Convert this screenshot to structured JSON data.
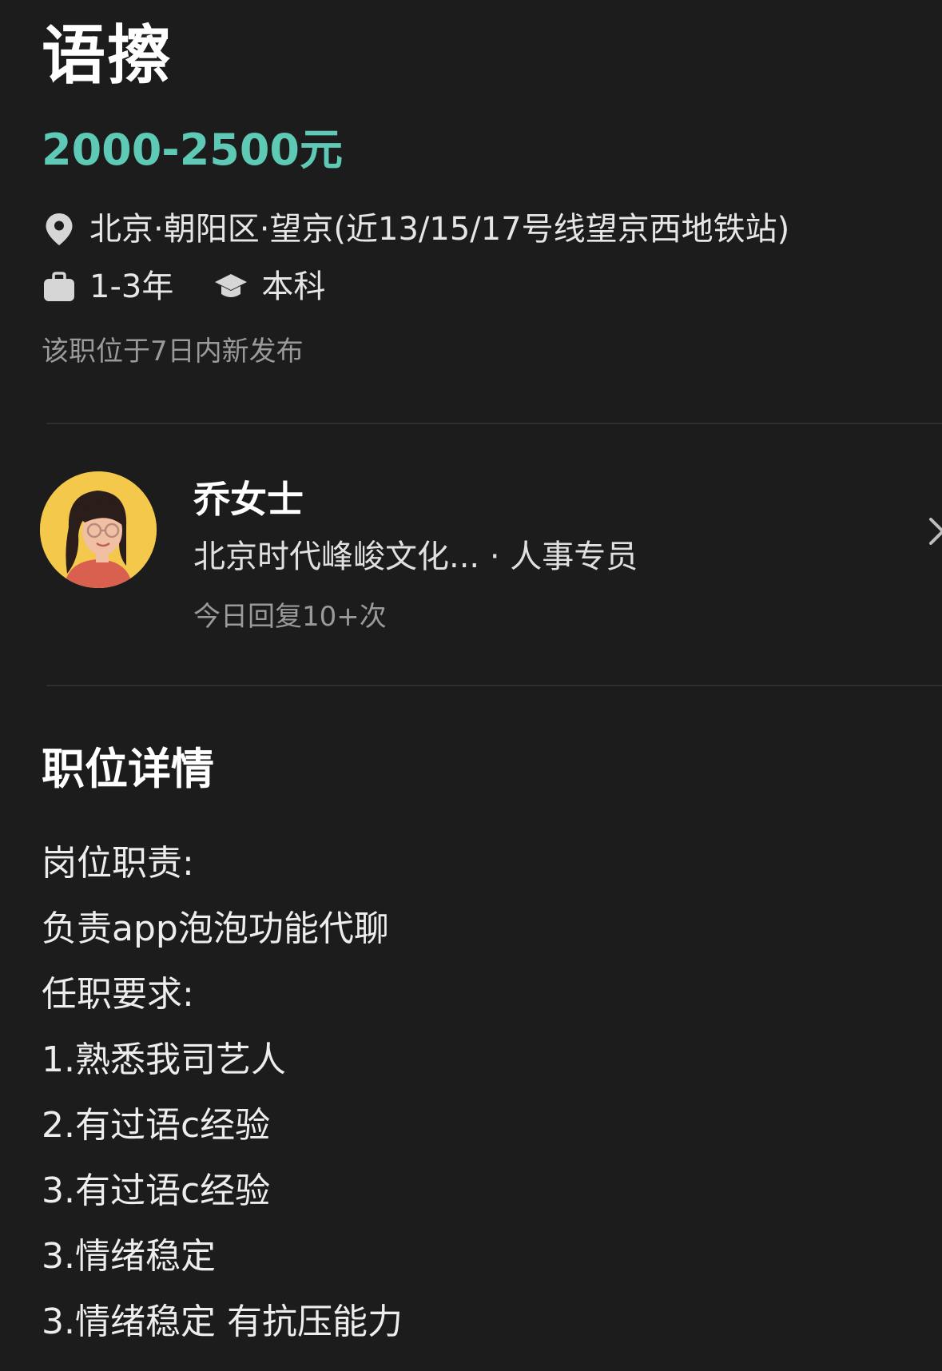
{
  "job": {
    "title": "语擦",
    "salary": "2000-2500元",
    "location": "北京·朝阳区·望京(近13/15/17号线望京西地铁站)",
    "experience": "1-3年",
    "education": "本科",
    "posted_note": "该职位于7日内新发布"
  },
  "icons": {
    "location": "location-pin-icon",
    "experience": "briefcase-icon",
    "education": "graduation-cap-icon",
    "recruiter_link": "chevron-right-icon"
  },
  "recruiter": {
    "name": "乔女士",
    "company_role": "北京时代峰峻文化... · 人事专员",
    "activity": "今日回复10+次"
  },
  "details": {
    "section_title": "职位详情",
    "lines": [
      "岗位职责:",
      "负责app泡泡功能代聊",
      "任职要求:",
      "1.熟悉我司艺人",
      "2.有过语c经验",
      "3.有过语c经验",
      "3.情绪稳定",
      "3.情绪稳定 有抗压能力"
    ]
  },
  "colors": {
    "background": "#1c1c1c",
    "salary": "#5ec9b5",
    "secondary_text": "#9a9a9a"
  }
}
